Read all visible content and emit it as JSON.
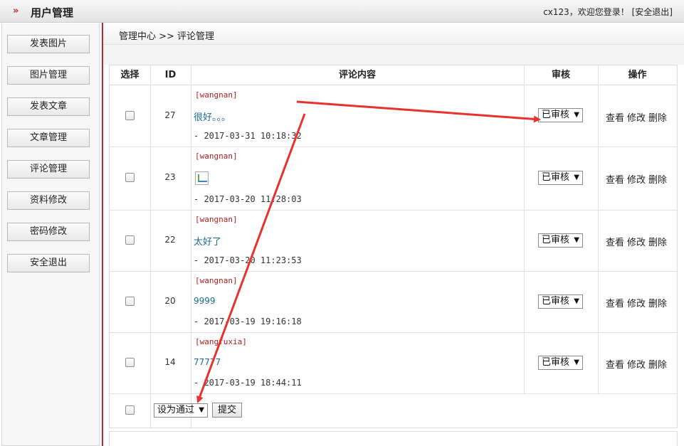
{
  "topbar": {
    "brand_icon": "»",
    "title": "用户管理",
    "user": "cx123，欢迎您登录！",
    "logout": "[安全退出]"
  },
  "sidebar": {
    "items": [
      {
        "label": "发表图片"
      },
      {
        "label": "图片管理"
      },
      {
        "label": "发表文章"
      },
      {
        "label": "文章管理"
      },
      {
        "label": "评论管理"
      },
      {
        "label": "资料修改"
      },
      {
        "label": "密码修改"
      },
      {
        "label": "安全退出"
      }
    ]
  },
  "breadcrumb": "管理中心 >> 评论管理",
  "table": {
    "headers": [
      "选择",
      "ID",
      "评论内容",
      "审核",
      "操作"
    ],
    "rows": [
      {
        "id": "27",
        "user": "[wangnan]",
        "content": "很好。。。",
        "has_image": false,
        "time": "- 2017-03-31 10:18:32",
        "status": "已审核"
      },
      {
        "id": "23",
        "user": "[wangnan]",
        "content": "",
        "has_image": true,
        "time": "- 2017-03-20 11:28:03",
        "status": "已审核"
      },
      {
        "id": "22",
        "user": "[wangnan]",
        "content": "太好了",
        "has_image": false,
        "time": "- 2017-03-20 11:23:53",
        "status": "已审核"
      },
      {
        "id": "20",
        "user": "[wangnan]",
        "content": "9999",
        "has_image": false,
        "time": "- 2017-03-19 19:16:18",
        "status": "已审核"
      },
      {
        "id": "14",
        "user": "[wangfuxia]",
        "content": "77777",
        "has_image": false,
        "time": "- 2017-03-19 18:44:11",
        "status": "已审核"
      }
    ],
    "ops": [
      "查看",
      "修改",
      "删除"
    ]
  },
  "batch": {
    "select_value": "设为通过",
    "submit_label": "提交"
  },
  "colors": {
    "accent": "#c0282a",
    "link_blue": "#1d6b93",
    "arrow_red": "#e8322d"
  }
}
